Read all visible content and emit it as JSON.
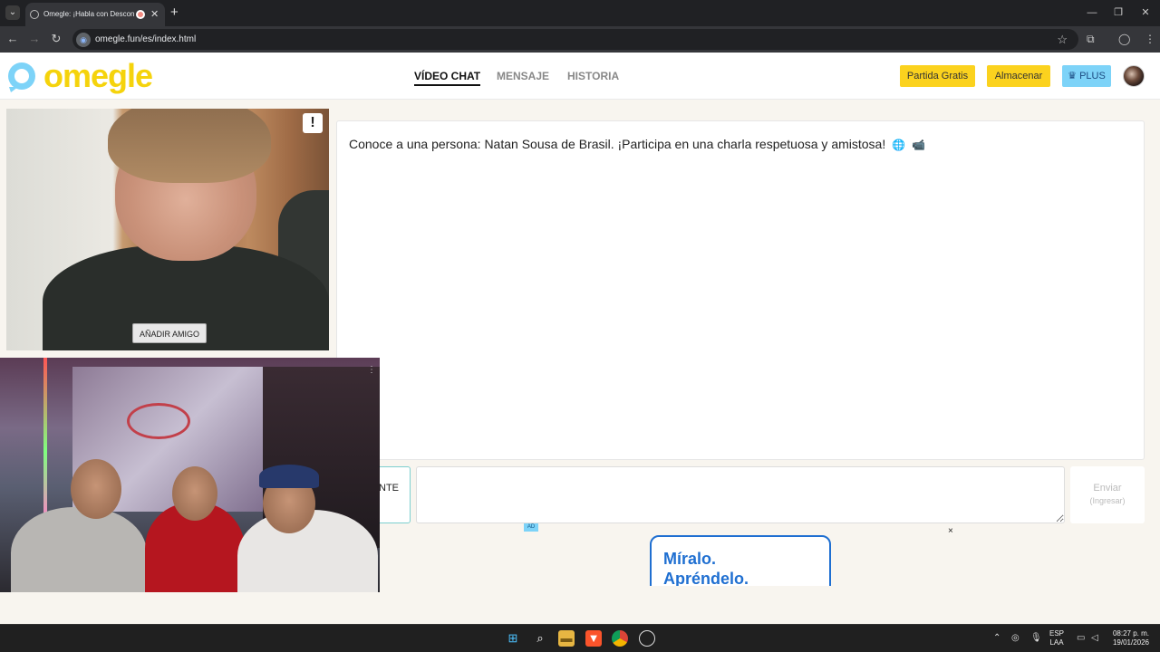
{
  "browser": {
    "tab_title": "Omegle: ¡Habla con Descon",
    "tab_close": "✕",
    "new_tab": "+",
    "url": "omegle.fun/es/index.html",
    "window_controls": [
      "—",
      "❐",
      "✕"
    ],
    "icons": [
      "back-icon",
      "forward-icon",
      "reload-icon",
      "star-icon",
      "extensions-icon",
      "profile-icon",
      "menu-icon"
    ]
  },
  "header": {
    "logo_text": "omegle",
    "nav": [
      {
        "label": "VÍDEO CHAT",
        "active": true
      },
      {
        "label": "MENSAJE",
        "active": false
      },
      {
        "label": "HISTORIA",
        "active": false
      }
    ],
    "partida_label": "Partida Gratis",
    "almacenar_label": "Almacenar",
    "plus_label": "PLUS",
    "plus_icon": "♛"
  },
  "video": {
    "report_label": "!",
    "add_friend_label": "AÑADIR AMIGO"
  },
  "chat": {
    "message": "Conoce a una persona: Natan Sousa de Brasil. ¡Participa en una charla respetuosa y amistosa!",
    "emoji_1": "🌐",
    "emoji_2": "📹",
    "next_label": "NTE",
    "input_placeholder": "",
    "send_label": "Enviar",
    "send_hint": "(Ingresar)"
  },
  "ad": {
    "badge": "AD",
    "close": "×",
    "line1": "Míralo.",
    "line2": "Apréndelo."
  },
  "taskbar": {
    "lang_top": "ESP",
    "lang_bottom": "LAA",
    "time": "08:27 p. m.",
    "date": "19/01/2026"
  },
  "colors": {
    "logo_yellow": "#f5d30c",
    "logo_blue": "#7dd3f8",
    "button_yellow": "#fbd21e",
    "plus_blue": "#7dd3f8",
    "ad_blue": "#1f6fd1"
  }
}
